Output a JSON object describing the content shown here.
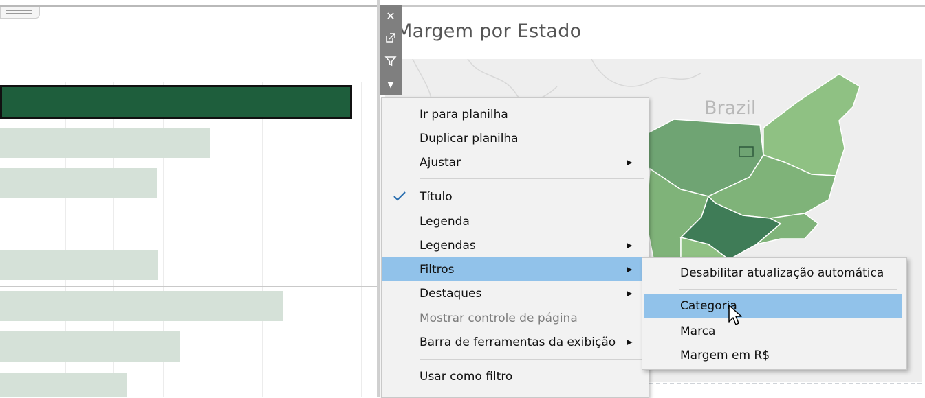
{
  "map": {
    "title": "Margem por Estado",
    "country_label": "Brazil"
  },
  "toolbar": {
    "close_glyph": "✕",
    "dropdown_glyph": "▼"
  },
  "context_menu": {
    "items": [
      {
        "label": "Ir para planilha",
        "submenu": false,
        "checked": false,
        "disabled": false,
        "highlighted": false
      },
      {
        "label": "Duplicar planilha",
        "submenu": false,
        "checked": false,
        "disabled": false,
        "highlighted": false
      },
      {
        "label": "Ajustar",
        "submenu": true,
        "checked": false,
        "disabled": false,
        "highlighted": false
      },
      {
        "label": "Título",
        "submenu": false,
        "checked": true,
        "disabled": false,
        "highlighted": false
      },
      {
        "label": "Legenda",
        "submenu": false,
        "checked": false,
        "disabled": false,
        "highlighted": false
      },
      {
        "label": "Legendas",
        "submenu": true,
        "checked": false,
        "disabled": false,
        "highlighted": false
      },
      {
        "label": "Filtros",
        "submenu": true,
        "checked": false,
        "disabled": false,
        "highlighted": true
      },
      {
        "label": "Destaques",
        "submenu": true,
        "checked": false,
        "disabled": false,
        "highlighted": false
      },
      {
        "label": "Mostrar controle de página",
        "submenu": false,
        "checked": false,
        "disabled": true,
        "highlighted": false
      },
      {
        "label": "Barra de ferramentas da exibição",
        "submenu": true,
        "checked": false,
        "disabled": false,
        "highlighted": false
      },
      {
        "label": "Usar como filtro",
        "submenu": false,
        "checked": false,
        "disabled": false,
        "highlighted": false
      }
    ],
    "submenu_glyph": "▶"
  },
  "filters_submenu": {
    "items": [
      {
        "label": "Desabilitar atualização automática",
        "highlighted": false
      },
      {
        "label": "Categoria",
        "highlighted": true
      },
      {
        "label": "Marca",
        "highlighted": false
      },
      {
        "label": "Margem em R$",
        "highlighted": false
      }
    ]
  },
  "colors": {
    "menu_highlight": "#91c2ea",
    "bar_selected": "#1e5e3c",
    "bar_default": "#d5e1d8",
    "toolbar_bg": "#7f7f7f",
    "map_dark": "#3f7c57",
    "map_mid": "#6fa473",
    "map_light": "#8fc183"
  }
}
